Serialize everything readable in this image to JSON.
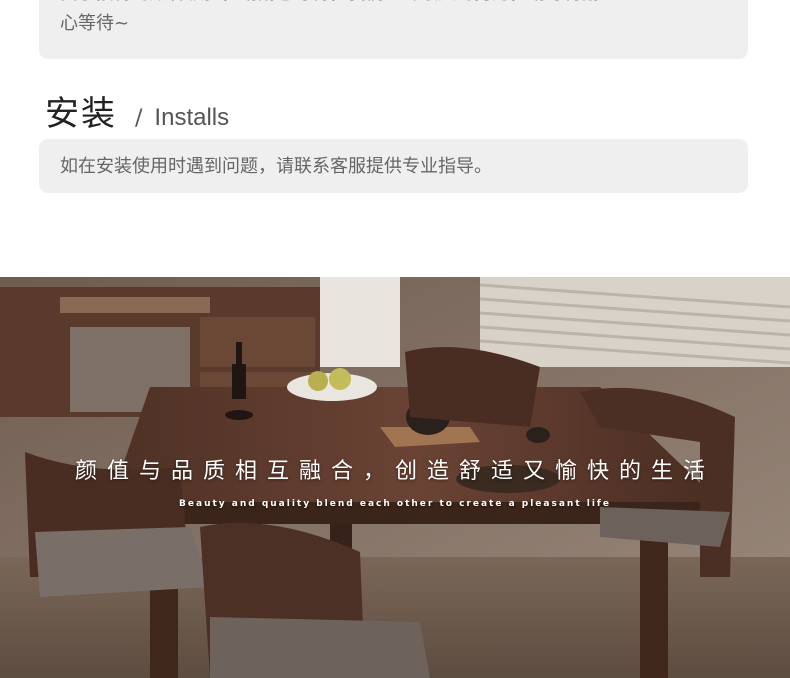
{
  "previous_note": {
    "line1": "由于接待的顾客较多，请耐心等待，我们已尽最大的努力，请等待耐",
    "line2": "心等待~"
  },
  "install_section": {
    "title_zh": "安装",
    "separator": "/",
    "title_en": "Installs",
    "note": "如在安装使用时遇到问题，请联系客服提供专业指导。"
  },
  "banner": {
    "slogan_zh": "颜值与品质相互融合，创造舒适又愉快的生活",
    "slogan_en": "Beauty and quality blend each other to create a pleasant life",
    "image_description": "dining-room-table-photo"
  },
  "colors": {
    "card_bg": "#efefef",
    "wood_dark": "#4a3024",
    "wall": "#8a7a6c"
  }
}
